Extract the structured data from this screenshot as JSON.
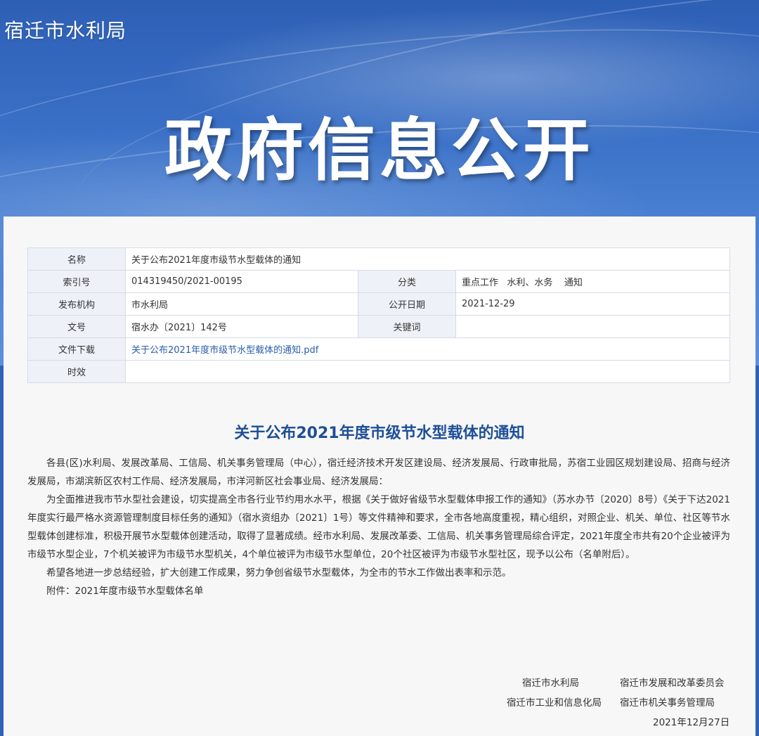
{
  "header": {
    "site_name": "宿迁市水利局",
    "banner_title": "政府信息公开"
  },
  "meta": {
    "name_label": "名称",
    "name_value": "关于公布2021年度市级节水型载体的通知",
    "index_label": "索引号",
    "index_value": "014319450/2021-00195",
    "category_label": "分类",
    "category_value": "重点工作   水利、水务    通知",
    "publisher_label": "发布机构",
    "publisher_value": "市水利局",
    "date_label": "公开日期",
    "date_value": "2021-12-29",
    "docno_label": "文号",
    "docno_value": "宿水办〔2021〕142号",
    "keywords_label": "关键词",
    "keywords_value": "",
    "download_label": "文件下载",
    "download_link": "关于公布2021年度市级节水型载体的通知.pdf",
    "validity_label": "时效",
    "validity_value": ""
  },
  "article": {
    "title": "关于公布2021年度市级节水型载体的通知",
    "paragraphs": [
      "各县(区)水利局、发展改革局、工信局、机关事务管理局（中心），宿迁经济技术开发区建设局、经济发展局、行政审批局，苏宿工业园区规划建设局、招商与经济发展局，市湖滨新区农村工作局、经济发展局，市洋河新区社会事业局、经济发展局：",
      "为全面推进我市节水型社会建设，切实提高全市各行业节约用水水平，根据《关于做好省级节水型载体申报工作的通知》（苏水办节〔2020〕8号）《关于下达2021年度实行最严格水资源管理制度目标任务的通知》（宿水资组办〔2021〕1号）等文件精神和要求，全市各地高度重视，精心组织，对照企业、机关、单位、社区等节水型载体创建标准，积极开展节水型载体创建活动，取得了显著成绩。经市水利局、发展改革委、工信局、机关事务管理局综合评定，2021年度全市共有20个企业被评为市级节水型企业，7个机关被评为市级节水型机关，4个单位被评为市级节水型单位，20个社区被评为市级节水型社区，现予以公布（名单附后）。",
      "希望各地进一步总结经验，扩大创建工作成果，努力争创省级节水型载体，为全市的节水工作做出表率和示范。",
      "附件：2021年度市级节水型载体名单"
    ]
  },
  "signatures": {
    "org1": "宿迁市水利局",
    "org2": "宿迁市发展和改革委员会",
    "org3": "宿迁市工业和信息化局",
    "org4": "宿迁市机关事务管理局",
    "date": "2021年12月27日"
  }
}
